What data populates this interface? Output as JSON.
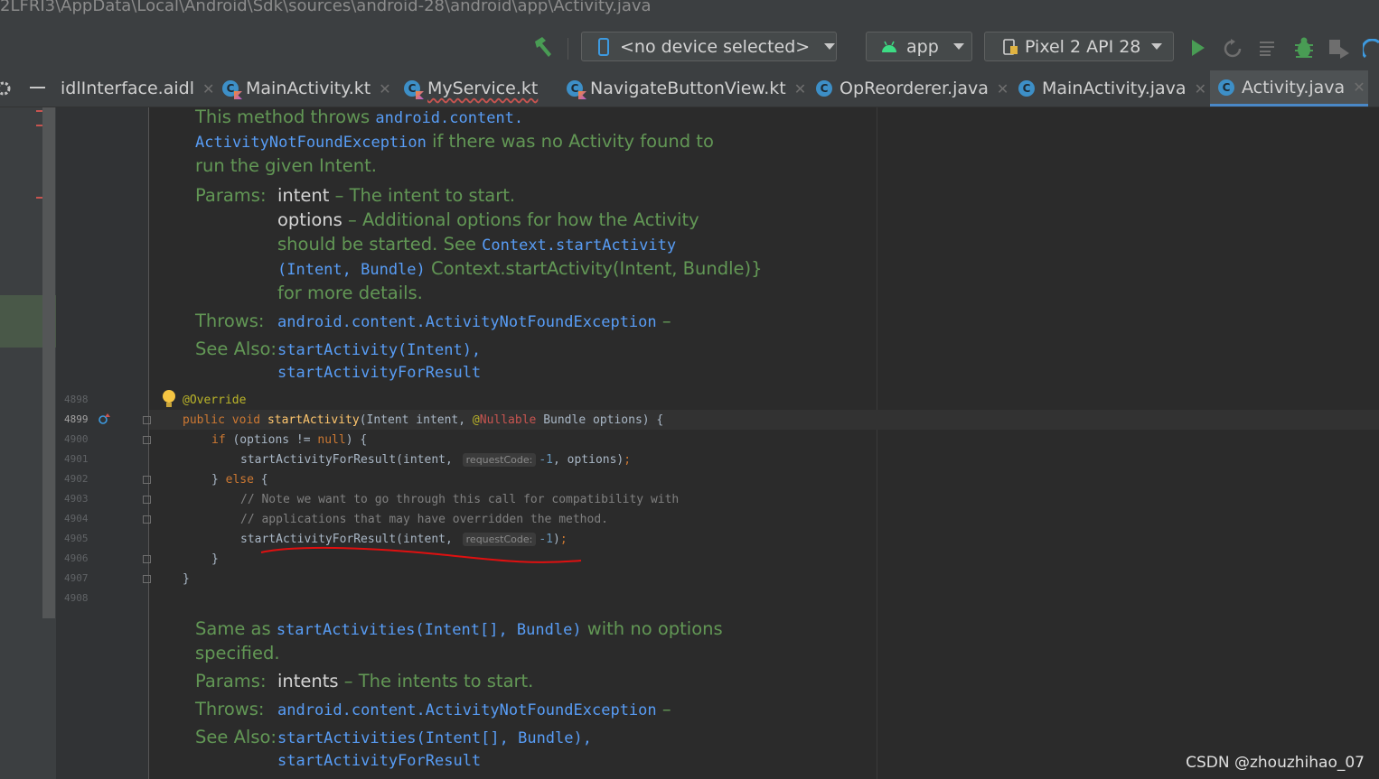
{
  "window": {
    "path": "2LFRI3\\AppData\\Local\\Android\\Sdk\\sources\\android-28\\android\\app\\Activity.java"
  },
  "toolbar": {
    "device_selector": "<no device selected>",
    "run_config": "app",
    "avd": "Pixel 2 API 28",
    "colors": {
      "run": "#499c54",
      "debug": "#499c54",
      "build": "#499c54"
    }
  },
  "tabs": [
    {
      "label": "idlInterface.aidl",
      "icon": "aidl-file-icon"
    },
    {
      "label": "MainActivity.kt",
      "icon": "kotlin-class-icon"
    },
    {
      "label": "MyService.kt",
      "icon": "kotlin-class-icon"
    },
    {
      "label": "NavigateButtonView.kt",
      "icon": "kotlin-class-icon"
    },
    {
      "label": "OpReorderer.java",
      "icon": "java-class-icon"
    },
    {
      "label": "MainActivity.java",
      "icon": "java-class-icon"
    },
    {
      "label": "Activity.java",
      "icon": "java-class-icon",
      "active": true
    }
  ],
  "doc1": {
    "line1a": "This method throws ",
    "line1b": "android.content.",
    "line2a": "ActivityNotFoundException",
    "line2b": " if there was no Activity found to",
    "line3": "run the given Intent.",
    "params_label": "Params:",
    "p1_name": "intent",
    "p1_desc": " – The intent to start.",
    "p2_name": "options",
    "p2_desc": " – Additional options for how the Activity",
    "p2_line2a": "should be started. See ",
    "p2_line2b": "Context.startActivity",
    "p2_line3a": "(Intent, Bundle)",
    "p2_line3b": " Context.startActivity(Intent, Bundle)}",
    "p2_line4": "for more details.",
    "throws_label": "Throws:",
    "throws_ref": "android.content.ActivityNotFoundException",
    "throws_dash": " –",
    "see_label": "See Also:",
    "see1": "startActivity(Intent),",
    "see2": "startActivityForResult"
  },
  "code": {
    "line_numbers": [
      "4898",
      "4899",
      "4900",
      "4901",
      "4902",
      "4903",
      "4904",
      "4905",
      "4906",
      "4907",
      "4908"
    ],
    "override": "@Override",
    "sig_public": "public ",
    "sig_void": "void ",
    "sig_name": "startActivity",
    "sig_args1": "(Intent intent, ",
    "sig_at": "@",
    "sig_nullable": "Nullable",
    "sig_args2": " Bundle options) {",
    "if_kw": "if",
    "if_rest1": " (options != ",
    "null_kw": "null",
    "if_rest2": ") {",
    "call1a": "startActivityForResult(intent, ",
    "hint": "requestCode:",
    "call1b": "-1",
    "call1c": ", options)",
    "semi": ";",
    "else_a": "} ",
    "else_kw": "else",
    "else_b": " {",
    "comment1": "// Note we want to go through this call for compatibility with",
    "comment2": "// applications that may have overridden the method.",
    "call2a": "startActivityForResult(intent, ",
    "call2b": "-1",
    "call2c": ")",
    "close_inner": "}",
    "close_outer": "}"
  },
  "doc2": {
    "line1a": "Same as ",
    "line1b": "startActivities(Intent[], Bundle)",
    "line1c": " with no options",
    "line2": "specified.",
    "params_label": "Params:",
    "p1_name": "intents",
    "p1_desc": " – The intents to start.",
    "throws_label": "Throws:",
    "throws_ref": "android.content.ActivityNotFoundException",
    "throws_dash": " –",
    "see_label": "See Also:",
    "see1": "startActivities(Intent[], Bundle),",
    "see2": "startActivityForResult"
  },
  "watermark": "CSDN @zhouzhihao_07"
}
